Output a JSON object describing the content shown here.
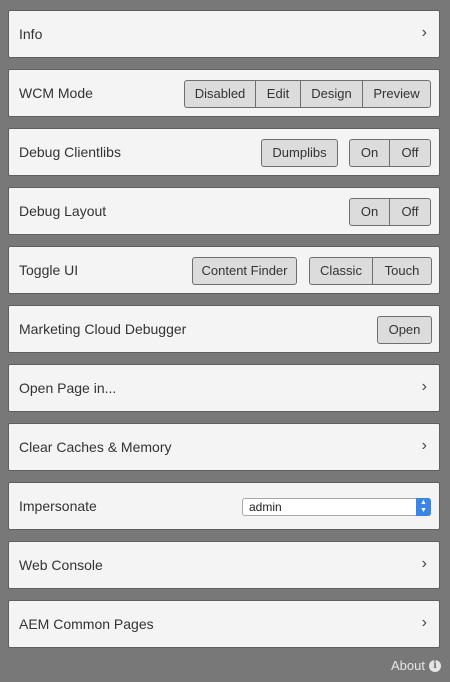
{
  "panels": {
    "info": {
      "label": "Info",
      "chevron": "›"
    },
    "wcm_mode": {
      "label": "WCM Mode",
      "options": [
        "Disabled",
        "Edit",
        "Design",
        "Preview"
      ]
    },
    "debug_clientlibs": {
      "label": "Debug Clientlibs",
      "dumplibs": "Dumplibs",
      "options": [
        "On",
        "Off"
      ]
    },
    "debug_layout": {
      "label": "Debug Layout",
      "options": [
        "On",
        "Off"
      ]
    },
    "toggle_ui": {
      "label": "Toggle UI",
      "content_finder": "Content Finder",
      "options": [
        "Classic",
        "Touch"
      ]
    },
    "marketing_cloud": {
      "label": "Marketing Cloud Debugger",
      "open": "Open"
    },
    "open_page": {
      "label": "Open Page in...",
      "chevron": "›"
    },
    "clear_caches": {
      "label": "Clear Caches & Memory",
      "chevron": "›"
    },
    "impersonate": {
      "label": "Impersonate",
      "selected": "admin"
    },
    "web_console": {
      "label": "Web Console",
      "chevron": "›"
    },
    "aem_common_pages": {
      "label": "AEM Common Pages",
      "chevron": "›"
    }
  },
  "footer": {
    "about": "About",
    "info_icon_glyph": "i"
  },
  "colors": {
    "background": "#787878",
    "panel": "#f4f4f4",
    "button": "#dcdcdc",
    "select_accent": "#3a86e8"
  }
}
